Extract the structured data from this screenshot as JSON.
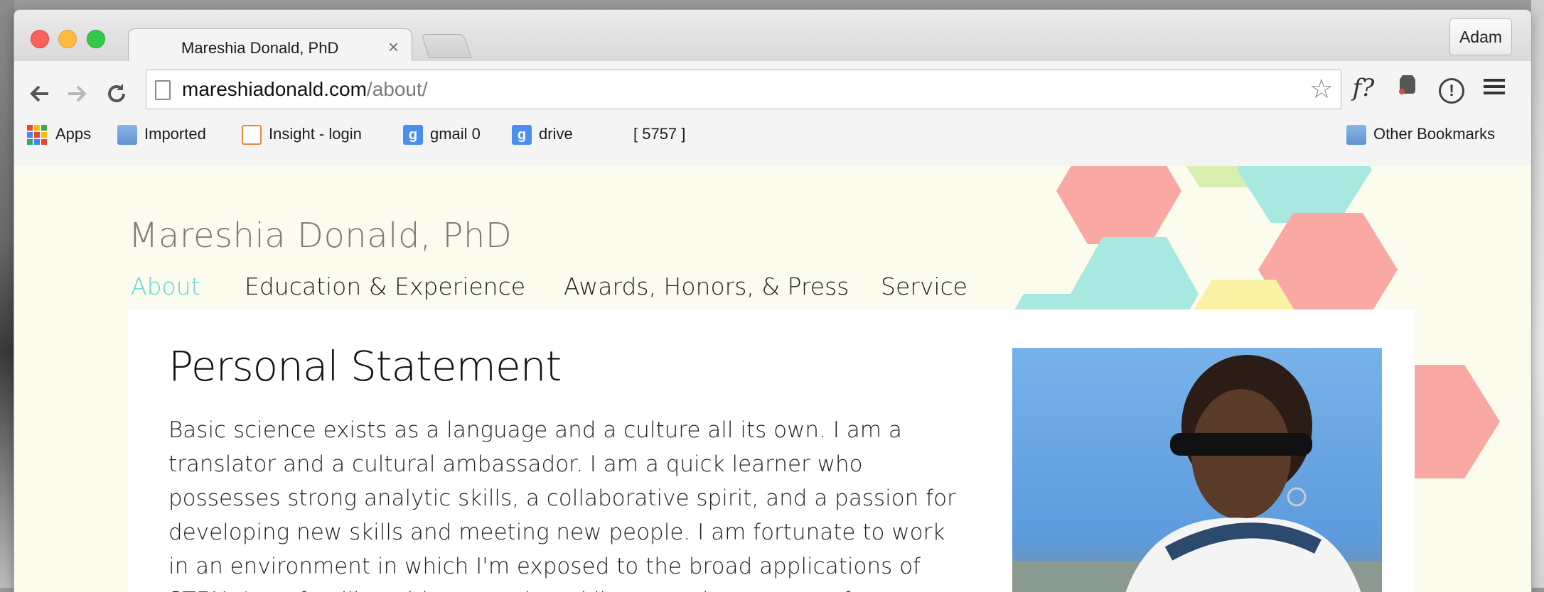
{
  "browser": {
    "tab_title": "Mareshia Donald, PhD",
    "tab_close": "×",
    "profile": "Adam",
    "url_domain": "mareshiadonald.com",
    "url_path": "/about/",
    "ext_f_label": "f?"
  },
  "bookmarks": {
    "items": [
      {
        "label": "Apps",
        "icon": "apps-grid-icon"
      },
      {
        "label": "Imported",
        "icon": "folder-icon"
      },
      {
        "label": "Insight - login",
        "icon": "insight-icon"
      },
      {
        "label": "gmail 0",
        "icon": "google-icon"
      },
      {
        "label": "drive",
        "icon": "google-icon"
      },
      {
        "label": "[  5757  ]",
        "icon": ""
      },
      {
        "label": "Other Bookmarks",
        "icon": "folder-icon"
      }
    ]
  },
  "site": {
    "title": "Mareshia Donald, PhD",
    "nav": [
      "About",
      "Education & Experience",
      "Awards, Honors, & Press",
      "Service"
    ],
    "active_nav": "About"
  },
  "content": {
    "heading": "Personal Statement",
    "body": "Basic science exists as a language and a culture all its own. I am a translator and a cultural ambassador. I am a quick learner who possesses strong analytic skills, a collaborative spirit, and a passion for developing new skills and meeting new people. I am fortunate to work in an environment in which I'm exposed to the broad applications of STEM. I am familiar with research and literature in an array of"
  },
  "colors": {
    "accent_teal": "#5fd6d2",
    "hex_pink": "#f9a8a3",
    "hex_teal": "#a7e9e0",
    "hex_yellow": "#f7f3a3",
    "hex_green": "#d7f0b0"
  }
}
